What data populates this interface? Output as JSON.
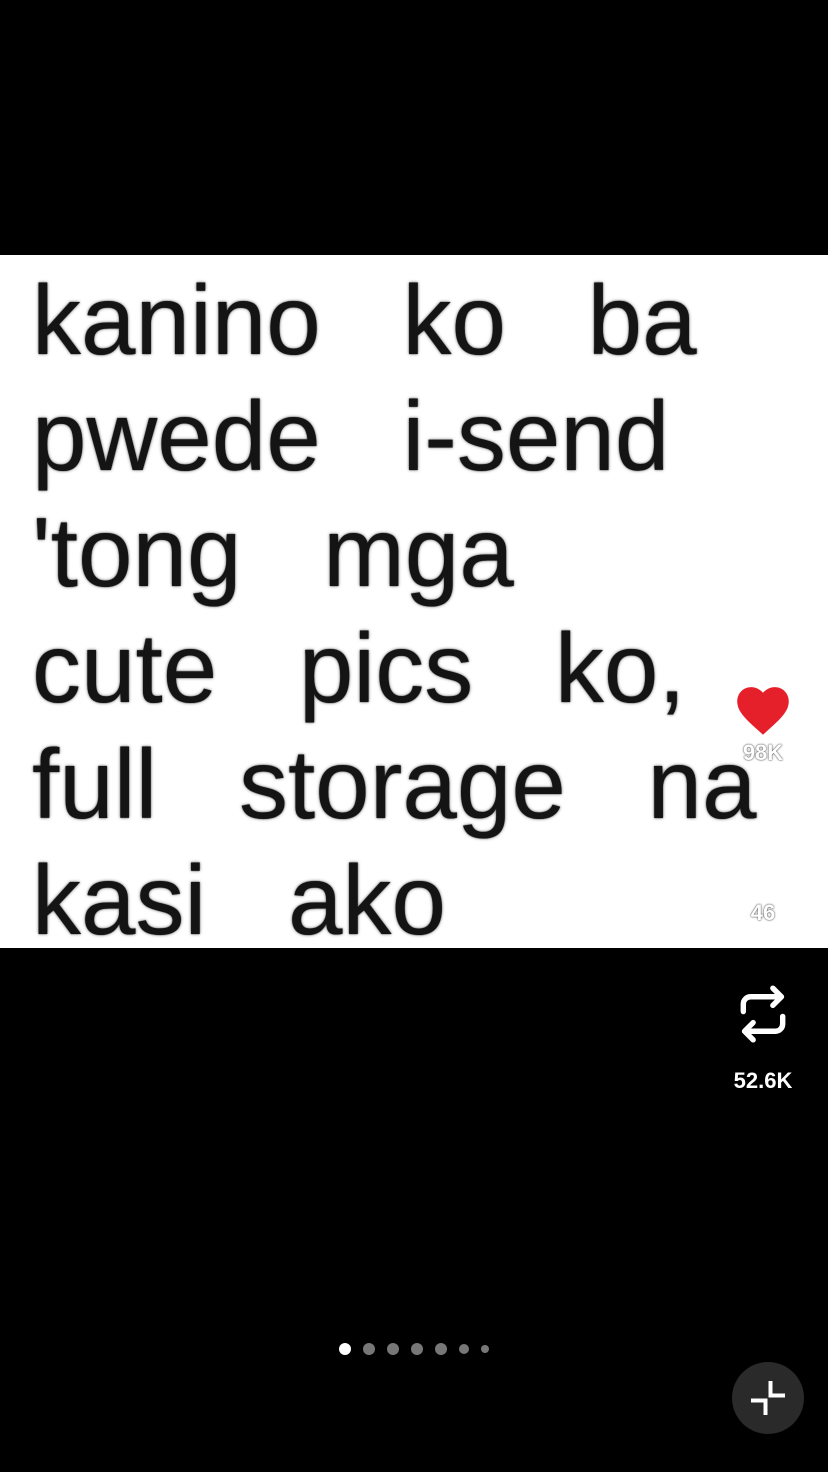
{
  "post": {
    "caption_lines": [
      "kanino   ko   ba",
      "pwede   i-send",
      "'tong   mga",
      "cute   pics   ko,",
      "full   storage   na",
      "kasi   ako"
    ]
  },
  "actions": {
    "like": {
      "icon": "heart-icon",
      "count": "98K",
      "color": "#e5202b"
    },
    "comment": {
      "icon": "comment-bubble-icon",
      "count": "46"
    },
    "repost": {
      "icon": "repost-icon",
      "count": "52.6K"
    }
  },
  "pagination": {
    "total": 7,
    "current": 1
  },
  "controls": {
    "collapse_icon": "collapse-icon"
  }
}
